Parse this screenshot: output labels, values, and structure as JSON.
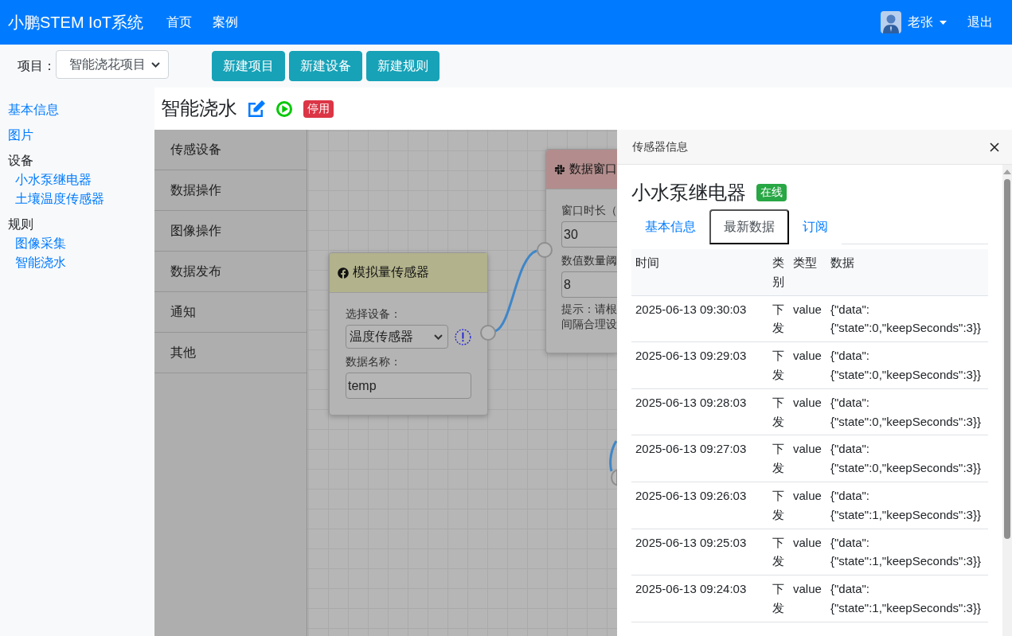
{
  "navbar": {
    "brand": "小鹏STEM IoT系统",
    "links": [
      {
        "label": "首页"
      },
      {
        "label": "案例"
      }
    ],
    "user_name": "老张",
    "logout": "退出"
  },
  "toolbar": {
    "project_label": "项目：",
    "project_select": "智能浇花项目",
    "buttons": [
      {
        "label": "新建项目"
      },
      {
        "label": "新建设备"
      },
      {
        "label": "新建规则"
      }
    ]
  },
  "sidebar": {
    "items": [
      {
        "kind": "link",
        "label": "基本信息"
      },
      {
        "kind": "link",
        "label": "图片"
      },
      {
        "kind": "group",
        "label": "设备",
        "children": [
          {
            "label": "小水泵继电器"
          },
          {
            "label": "土壤温度传感器"
          }
        ]
      },
      {
        "kind": "group",
        "label": "规则",
        "children": [
          {
            "label": "图像采集"
          },
          {
            "label": "智能浇水"
          }
        ]
      }
    ]
  },
  "rule": {
    "title": "智能浇水",
    "badge": "停用"
  },
  "palette": {
    "items": [
      {
        "label": "传感设备"
      },
      {
        "label": "数据操作"
      },
      {
        "label": "图像操作"
      },
      {
        "label": "数据发布"
      },
      {
        "label": "通知"
      },
      {
        "label": "其他"
      }
    ]
  },
  "canvas": {
    "nodes": [
      {
        "kind": "sensor",
        "title": "模拟量传感器",
        "fields": [
          {
            "kind": "select",
            "label": "选择设备：",
            "value": "温度传感器",
            "warning": true
          },
          {
            "kind": "input",
            "label": "数据名称：",
            "value": "temp"
          }
        ]
      },
      {
        "kind": "window",
        "title": "数据窗口",
        "fields": [
          {
            "kind": "input",
            "label": "窗口时长（",
            "value": "30"
          },
          {
            "kind": "input",
            "label": "数值数量阈",
            "value": "8"
          }
        ],
        "hint_lines": [
          "提示：请根",
          "间隔合理设"
        ]
      }
    ]
  },
  "detail_panel": {
    "title": "传感器信息",
    "device_name": "小水泵继电器",
    "status": "在线",
    "tabs": [
      {
        "label": "基本信息",
        "selected": false
      },
      {
        "label": "最新数据",
        "selected": true
      },
      {
        "label": "订阅",
        "selected": false
      }
    ],
    "table": {
      "columns": [
        "时间",
        "类别",
        "类型",
        "数据"
      ],
      "rows": [
        {
          "time": "2025-06-13 09:30:03",
          "category": "下发",
          "type": "value",
          "data": "{\"data\":{\"state\":0,\"keepSeconds\":3}}"
        },
        {
          "time": "2025-06-13 09:29:03",
          "category": "下发",
          "type": "value",
          "data": "{\"data\":{\"state\":0,\"keepSeconds\":3}}"
        },
        {
          "time": "2025-06-13 09:28:03",
          "category": "下发",
          "type": "value",
          "data": "{\"data\":{\"state\":0,\"keepSeconds\":3}}"
        },
        {
          "time": "2025-06-13 09:27:03",
          "category": "下发",
          "type": "value",
          "data": "{\"data\":{\"state\":0,\"keepSeconds\":3}}"
        },
        {
          "time": "2025-06-13 09:26:03",
          "category": "下发",
          "type": "value",
          "data": "{\"data\":{\"state\":1,\"keepSeconds\":3}}"
        },
        {
          "time": "2025-06-13 09:25:03",
          "category": "下发",
          "type": "value",
          "data": "{\"data\":{\"state\":1,\"keepSeconds\":3}}"
        },
        {
          "time": "2025-06-13 09:24:03",
          "category": "下发",
          "type": "value",
          "data": "{\"data\":{\"state\":1,\"keepSeconds\":3}}"
        }
      ]
    }
  }
}
